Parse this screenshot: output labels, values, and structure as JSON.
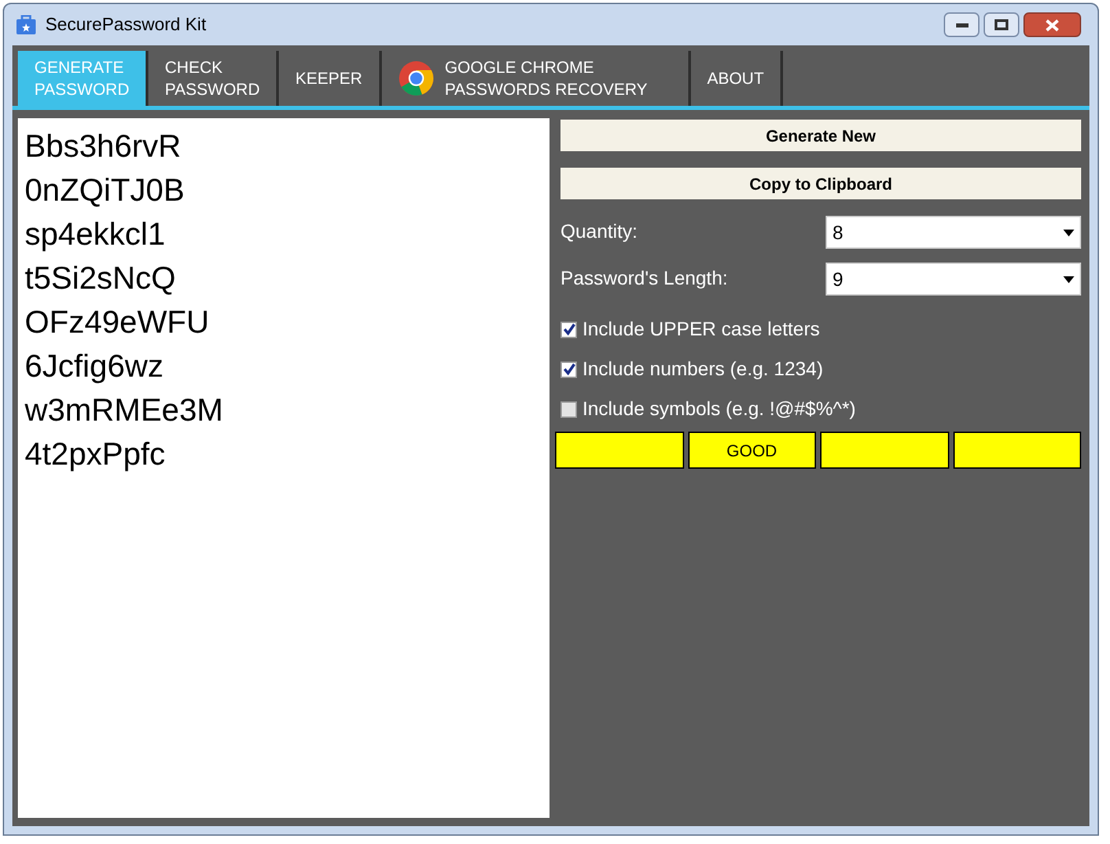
{
  "window": {
    "title": "SecurePassword Kit"
  },
  "tabs": [
    {
      "label": "GENERATE PASSWORD",
      "kind": "plain",
      "selected": true
    },
    {
      "label": "CHECK PASSWORD",
      "kind": "plain",
      "selected": false
    },
    {
      "label": "KEEPER",
      "kind": "plain",
      "selected": false
    },
    {
      "label": "GOOGLE CHROME PASSWORDS RECOVERY",
      "kind": "chrome",
      "selected": false
    },
    {
      "label": "ABOUT",
      "kind": "plain",
      "selected": false
    }
  ],
  "passwords": [
    "Bbs3h6rvR",
    "0nZQiTJ0B",
    "sp4ekkcl1",
    "t5Si2sNcQ",
    "OFz49eWFU",
    "6Jcfig6wz",
    "w3mRMEe3M",
    "4t2pxPpfc"
  ],
  "buttons": [
    "Generate New",
    "Copy to Clipboard"
  ],
  "fields": [
    {
      "label": "Quantity:",
      "value": "8"
    },
    {
      "label": "Password's Length:",
      "value": "9"
    }
  ],
  "options": [
    {
      "label": "Include UPPER case letters",
      "checked": true
    },
    {
      "label": "Include numbers (e.g. 1234)",
      "checked": true
    },
    {
      "label": "Include symbols (e.g. !@#$%^*)",
      "checked": false
    }
  ],
  "strength": {
    "label": "GOOD"
  }
}
